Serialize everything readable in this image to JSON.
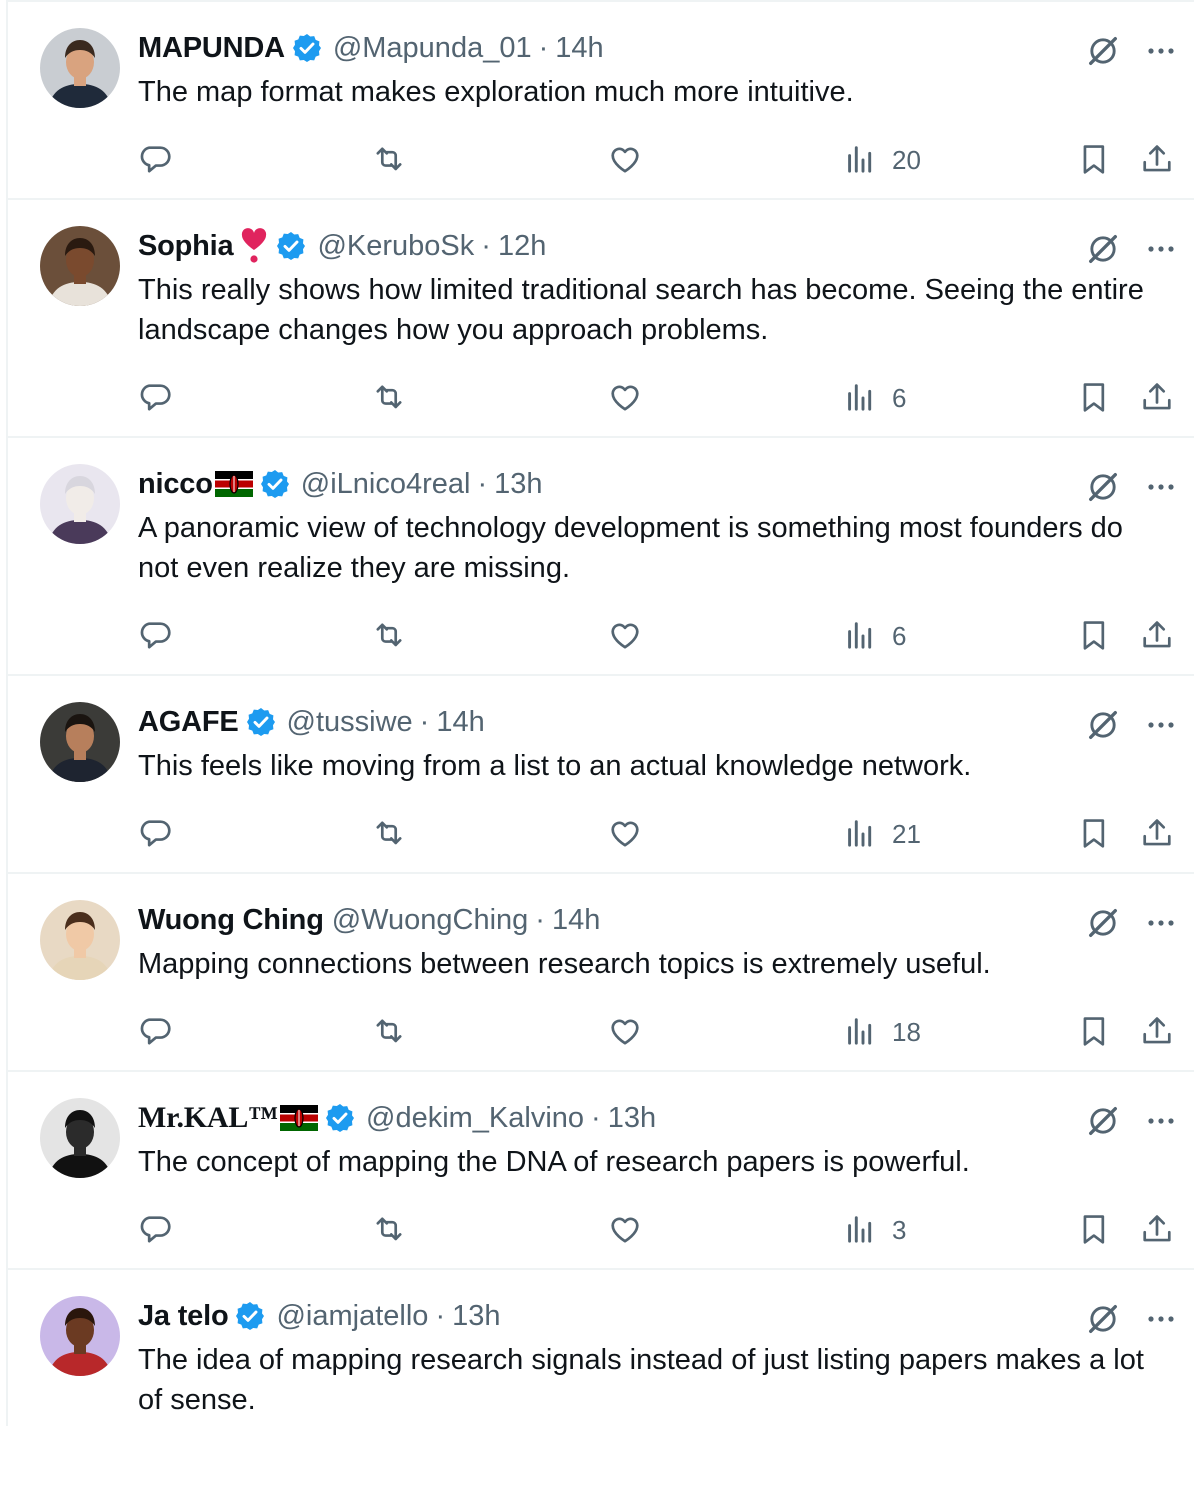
{
  "tweets": [
    {
      "name": "MAPUNDA",
      "handle": "@Mapunda_01",
      "separator": "·",
      "time": "14h",
      "verified": true,
      "emoji": "",
      "flag": false,
      "text": "The map format makes exploration much more intuitive.",
      "views": "20",
      "avatar": {
        "bg": "#c9cdd2",
        "skin": "#d9a37f",
        "hair": "#3a2a1f",
        "shirt": "#1f2a3a"
      }
    },
    {
      "name": "Sophia",
      "handle": "@KeruboSk",
      "separator": "·",
      "time": "12h",
      "verified": true,
      "emoji": "❣",
      "flag": false,
      "text": "This really shows how limited traditional search has become. Seeing the entire landscape changes how you approach problems.",
      "views": "6",
      "avatar": {
        "bg": "#6b4f3a",
        "skin": "#7a4a2e",
        "hair": "#2a1a10",
        "shirt": "#e8e2da"
      }
    },
    {
      "name": "nicco",
      "handle": "@iLnico4real",
      "separator": "·",
      "time": "13h",
      "verified": true,
      "emoji": "",
      "flag": true,
      "text": "A panoramic view of technology development is something most founders do not even realize they are missing.",
      "views": "6",
      "avatar": {
        "bg": "#e9e6ef",
        "skin": "#f1ece8",
        "hair": "#d8d6de",
        "shirt": "#4a3a5a"
      }
    },
    {
      "name": "AGAFE",
      "handle": "@tussiwe",
      "separator": "·",
      "time": "14h",
      "verified": true,
      "emoji": "",
      "flag": false,
      "text": "This feels like moving from a list to an actual knowledge network.",
      "views": "21",
      "avatar": {
        "bg": "#3b3b38",
        "skin": "#b77f5c",
        "hair": "#1a1410",
        "shirt": "#1e2430"
      }
    },
    {
      "name": "Wuong Ching",
      "handle": "@WuongChing",
      "separator": "·",
      "time": "14h",
      "verified": false,
      "emoji": "",
      "flag": false,
      "text": "Mapping connections between research topics is extremely useful.",
      "views": "18",
      "avatar": {
        "bg": "#e8d9c4",
        "skin": "#f0c9a6",
        "hair": "#4a2e1c",
        "shirt": "#e6d5b8"
      }
    },
    {
      "name": "Mr.KAL™",
      "handle": "@dekim_Kalvino",
      "separator": "·",
      "time": "13h",
      "verified": true,
      "emoji": "",
      "flag": true,
      "serif": true,
      "text": "The concept of mapping the DNA of research papers is powerful.",
      "views": "3",
      "avatar": {
        "bg": "#e4e4e4",
        "skin": "#2b2b2b",
        "hair": "#111111",
        "shirt": "#111111"
      }
    },
    {
      "name": "Ja telo",
      "handle": "@iamjatello",
      "separator": "·",
      "time": "13h",
      "verified": true,
      "emoji": "",
      "flag": false,
      "text": "The idea of mapping research signals instead of just listing papers makes a lot of sense.",
      "views": "",
      "avatar": {
        "bg": "#c9b8e8",
        "skin": "#6b3a22",
        "hair": "#2a160c",
        "shirt": "#b8282a"
      }
    }
  ],
  "colors": {
    "text": "#0f1419",
    "secondary": "#536471",
    "verified": "#1d9bf0",
    "border": "#eff3f4",
    "heart_emoji": "#e0245e"
  },
  "icons": [
    "verified-badge-icon",
    "grok-icon",
    "more-icon",
    "reply-icon",
    "retweet-icon",
    "like-icon",
    "views-icon",
    "bookmark-icon",
    "share-icon",
    "heart-exclamation-emoji",
    "kenya-flag-emoji"
  ]
}
